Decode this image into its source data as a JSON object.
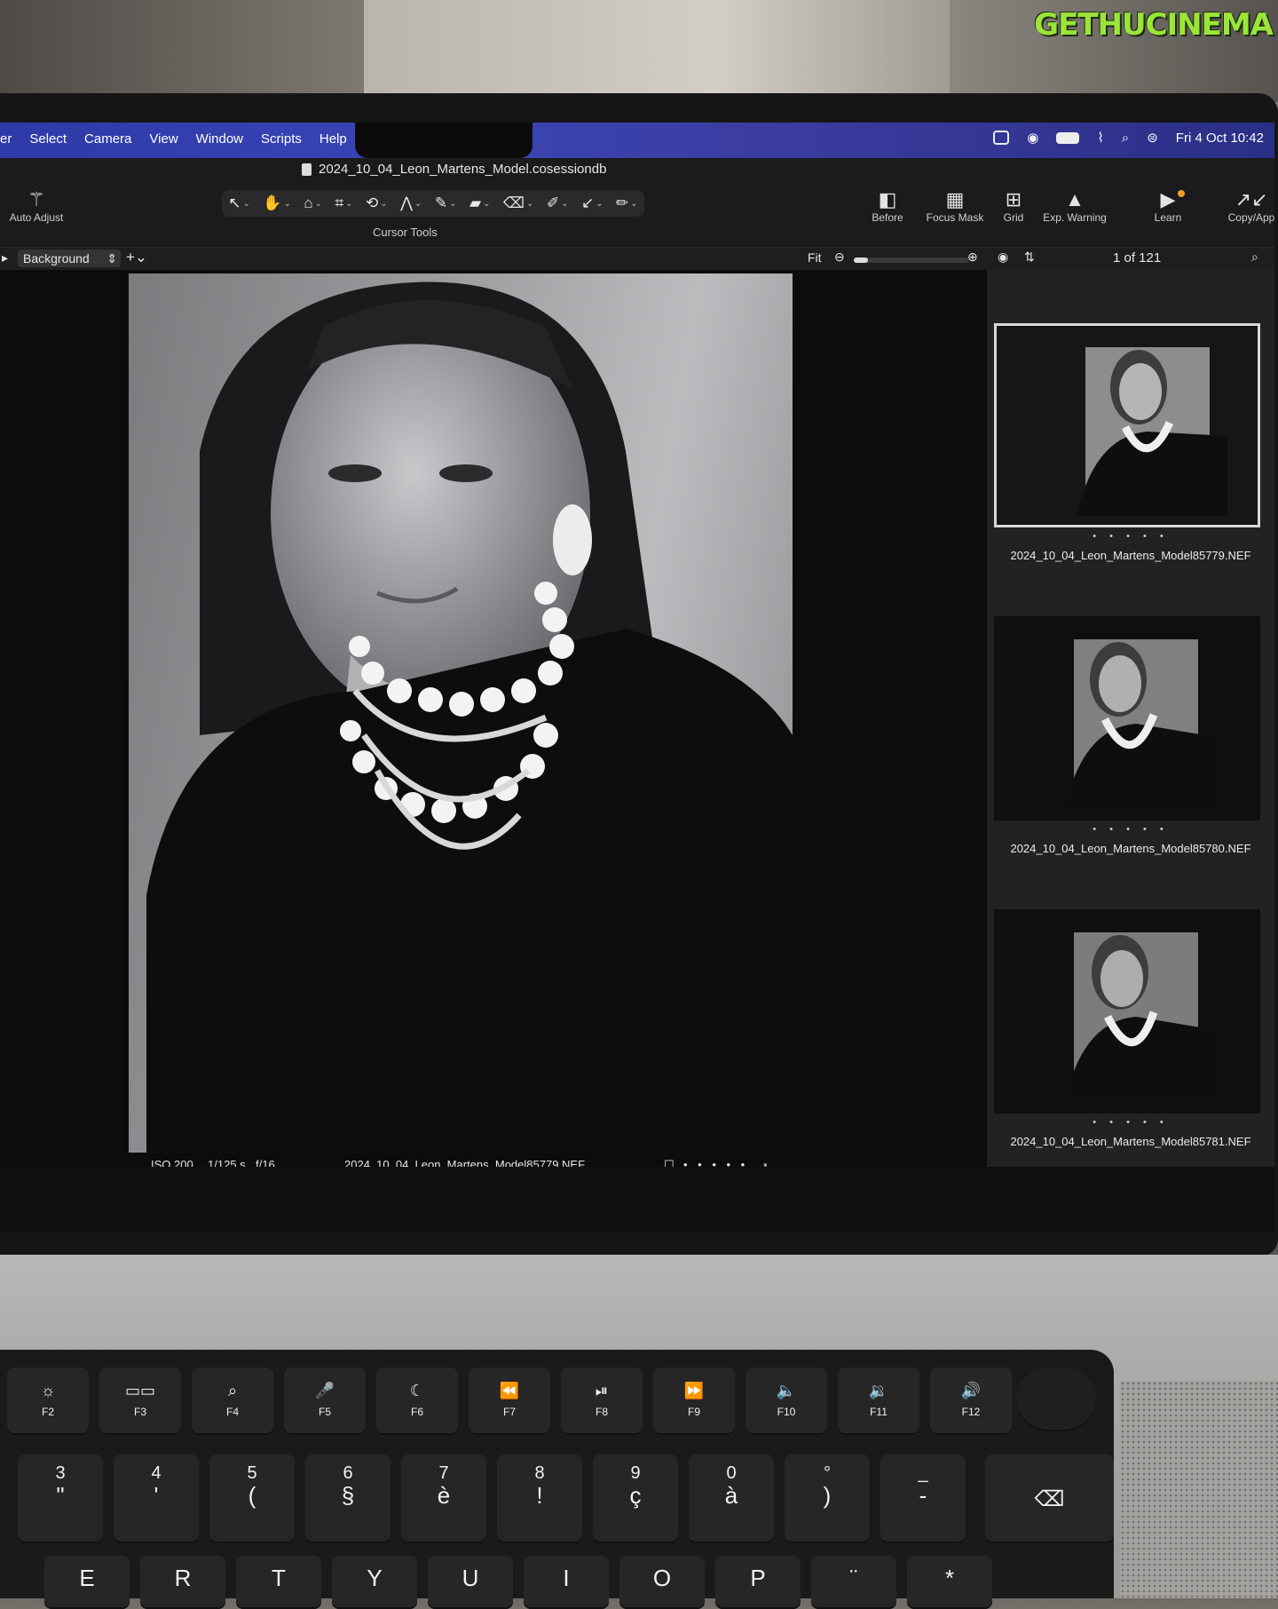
{
  "watermark": "GETHUCINEMA",
  "menubar": {
    "items": [
      "er",
      "Select",
      "Camera",
      "View",
      "Window",
      "Scripts",
      "Help"
    ],
    "clock": "Fri 4 Oct  10:42"
  },
  "window": {
    "title": "2024_10_04_Leon_Martens_Model.cosessiondb"
  },
  "toolbar": {
    "auto_adjust": "Auto Adjust",
    "cursor_tools": "Cursor Tools",
    "before": "Before",
    "focus_mask": "Focus Mask",
    "grid": "Grid",
    "exp_warning": "Exp. Warning",
    "learn": "Learn",
    "copy_apply": "Copy/App"
  },
  "subbar": {
    "layer": "Background",
    "fit": "Fit",
    "zoom_fraction": 0.12,
    "counter": "1 of 121"
  },
  "viewer": {
    "iso": "ISO 200",
    "shutter": "1/125 s",
    "aperture": "f/16",
    "filename": "2024_10_04_Leon_Martens_Model85779.NEF",
    "rating": "• • • • •"
  },
  "browser": {
    "thumbnails": [
      {
        "name": "2024_10_04_Leon_Martens_Model85779.NEF",
        "rating": "• • • • •"
      },
      {
        "name": "2024_10_04_Leon_Martens_Model85780.NEF",
        "rating": "• • • • •"
      },
      {
        "name": "2024_10_04_Leon_Martens_Model85781.NEF",
        "rating": "• • • • •"
      }
    ]
  },
  "keyboard": {
    "fn_row": [
      {
        "icon": "☼",
        "label": "F2"
      },
      {
        "icon": "▭▭",
        "label": "F3"
      },
      {
        "icon": "⌕",
        "label": "F4"
      },
      {
        "icon": "🎤",
        "label": "F5"
      },
      {
        "icon": "☾",
        "label": "F6"
      },
      {
        "icon": "⏪",
        "label": "F7"
      },
      {
        "icon": "⏯",
        "label": "F8"
      },
      {
        "icon": "⏩",
        "label": "F9"
      },
      {
        "icon": "🔈",
        "label": "F10"
      },
      {
        "icon": "🔉",
        "label": "F11"
      },
      {
        "icon": "🔊",
        "label": "F12"
      }
    ],
    "num_row": [
      {
        "top": "3",
        "bottom": "\""
      },
      {
        "top": "4",
        "bottom": "'"
      },
      {
        "top": "5",
        "bottom": "("
      },
      {
        "top": "6",
        "bottom": "§"
      },
      {
        "top": "7",
        "bottom": "è"
      },
      {
        "top": "8",
        "bottom": "!"
      },
      {
        "top": "9",
        "bottom": "ç"
      },
      {
        "top": "0",
        "bottom": "à"
      },
      {
        "top": "°",
        "bottom": ")"
      },
      {
        "top": "_",
        "bottom": "-"
      }
    ],
    "letter_row": [
      "E",
      "R",
      "T",
      "Y",
      "U",
      "I",
      "O",
      "P",
      "¨",
      "*"
    ],
    "delete": "⌫"
  }
}
